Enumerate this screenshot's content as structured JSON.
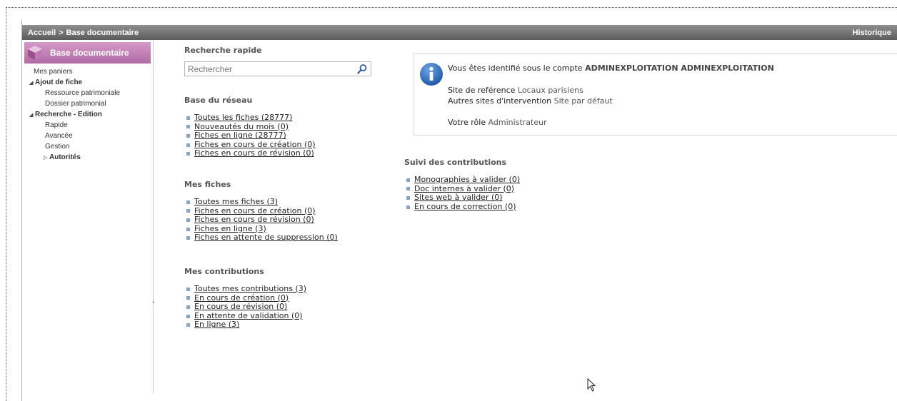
{
  "header": {
    "breadcrumb_home": "Accueil",
    "breadcrumb_sep": ">",
    "breadcrumb_current": "Base documentaire",
    "history": "Historique"
  },
  "sidebar": {
    "title": "Base documentaire",
    "items": [
      {
        "label": "Mes paniers"
      },
      {
        "label": "Ajout de fiche"
      },
      {
        "label": "Ressource patrimoniale"
      },
      {
        "label": "Dossier patrimonial"
      },
      {
        "label": "Recherche - Edition"
      },
      {
        "label": "Rapide"
      },
      {
        "label": "Avancée"
      },
      {
        "label": "Gestion"
      },
      {
        "label": "Autorités"
      }
    ]
  },
  "quick_search": {
    "title": "Recherche rapide",
    "placeholder": "Rechercher"
  },
  "network_base": {
    "title": "Base du réseau",
    "links": [
      "Toutes les fiches (28777)",
      "Nouveautés du mois (0)",
      "Fiches en ligne (28777)",
      "Fiches en cours de création (0)",
      "Fiches en cours de révision (0)"
    ]
  },
  "my_records": {
    "title": "Mes fiches",
    "links": [
      "Toutes mes fiches (3)",
      "Fiches en cours de création (0)",
      "Fiches en cours de révision (0)",
      "Fiches en ligne (3)",
      "Fiches en attente de suppression (0)"
    ]
  },
  "my_contributions": {
    "title": "Mes contributions",
    "links": [
      "Toutes mes contributions (3)",
      "En cours de création (0)",
      "En cours de révision (0)",
      "En attente de validation (0)",
      "En ligne (3)"
    ]
  },
  "info": {
    "identified_prefix": "Vous êtes identifié sous le compte",
    "account": "ADMINEXPLOITATION ADMINEXPLOITATION",
    "ref_site_prefix": "Site de reférence",
    "ref_site": "Locaux parisiens",
    "other_sites_prefix": "Autres sites d'intervention",
    "other_sites": "Site par défaut",
    "role_prefix": "Votre rôle",
    "role": "Administrateur"
  },
  "contribution_tracking": {
    "title": "Suivi des contributions",
    "links": [
      "Monographies à valider (0)",
      "Doc internes à valider (0)",
      "Sites web à valider (0)",
      "En cours de correction (0)"
    ]
  },
  "colors": {
    "sidebar_header": "#b26aa6",
    "topbar": "#6b6b6b",
    "bullet": "#8aa2c8",
    "info_icon": "#2f6db5"
  }
}
